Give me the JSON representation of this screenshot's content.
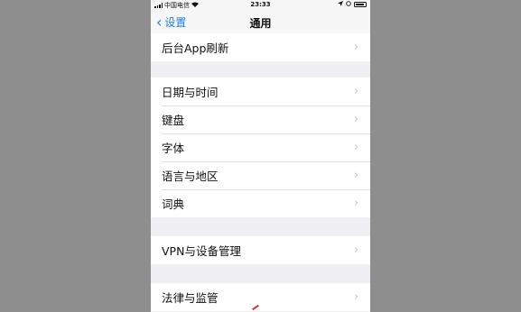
{
  "status_bar": {
    "carrier": "中国电信",
    "time": "23:33"
  },
  "nav": {
    "back_label": "设置",
    "title": "通用"
  },
  "groups": [
    {
      "rows": [
        {
          "label": "后台App刷新"
        }
      ]
    },
    {
      "rows": [
        {
          "label": "日期与时间"
        },
        {
          "label": "键盘"
        },
        {
          "label": "字体"
        },
        {
          "label": "语言与地区"
        },
        {
          "label": "词典"
        }
      ]
    },
    {
      "rows": [
        {
          "label": "VPN与设备管理"
        }
      ]
    },
    {
      "rows": [
        {
          "label": "法律与监管"
        }
      ]
    }
  ],
  "icons": {
    "back": "chevron-left-icon",
    "row_arrow": "chevron-right-icon",
    "signal": "signal-icon",
    "wifi": "wifi-icon",
    "location": "location-arrow-icon",
    "alarm": "alarm-icon",
    "battery": "battery-icon"
  },
  "colors": {
    "accent": "#1a7cf5",
    "background": "#efeff4",
    "cell": "#ffffff"
  }
}
